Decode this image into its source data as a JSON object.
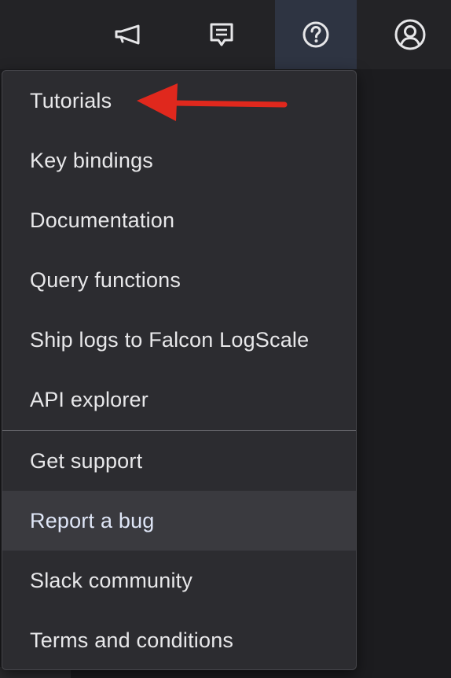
{
  "topbar": {
    "icons": {
      "announcements": "megaphone-icon",
      "messages": "chat-icon",
      "help": "question-circle-icon",
      "account": "user-circle-icon"
    }
  },
  "help_menu": {
    "items": [
      {
        "label": "Tutorials"
      },
      {
        "label": "Key bindings"
      },
      {
        "label": "Documentation"
      },
      {
        "label": "Query functions"
      },
      {
        "label": "Ship logs to Falcon LogScale"
      },
      {
        "label": "API explorer"
      },
      {
        "label": "Get support"
      },
      {
        "label": "Report a bug"
      },
      {
        "label": "Slack community"
      },
      {
        "label": "Terms and conditions"
      }
    ],
    "hovered_index": 7
  },
  "annotation": {
    "arrow_color": "#e0281d"
  },
  "colors": {
    "topbar_bg": "#232326",
    "active_tab_bg": "#2e3442",
    "menu_bg": "#2c2c30",
    "menu_hover_bg": "#3a3a3f",
    "menu_text": "#e8e8ea"
  }
}
